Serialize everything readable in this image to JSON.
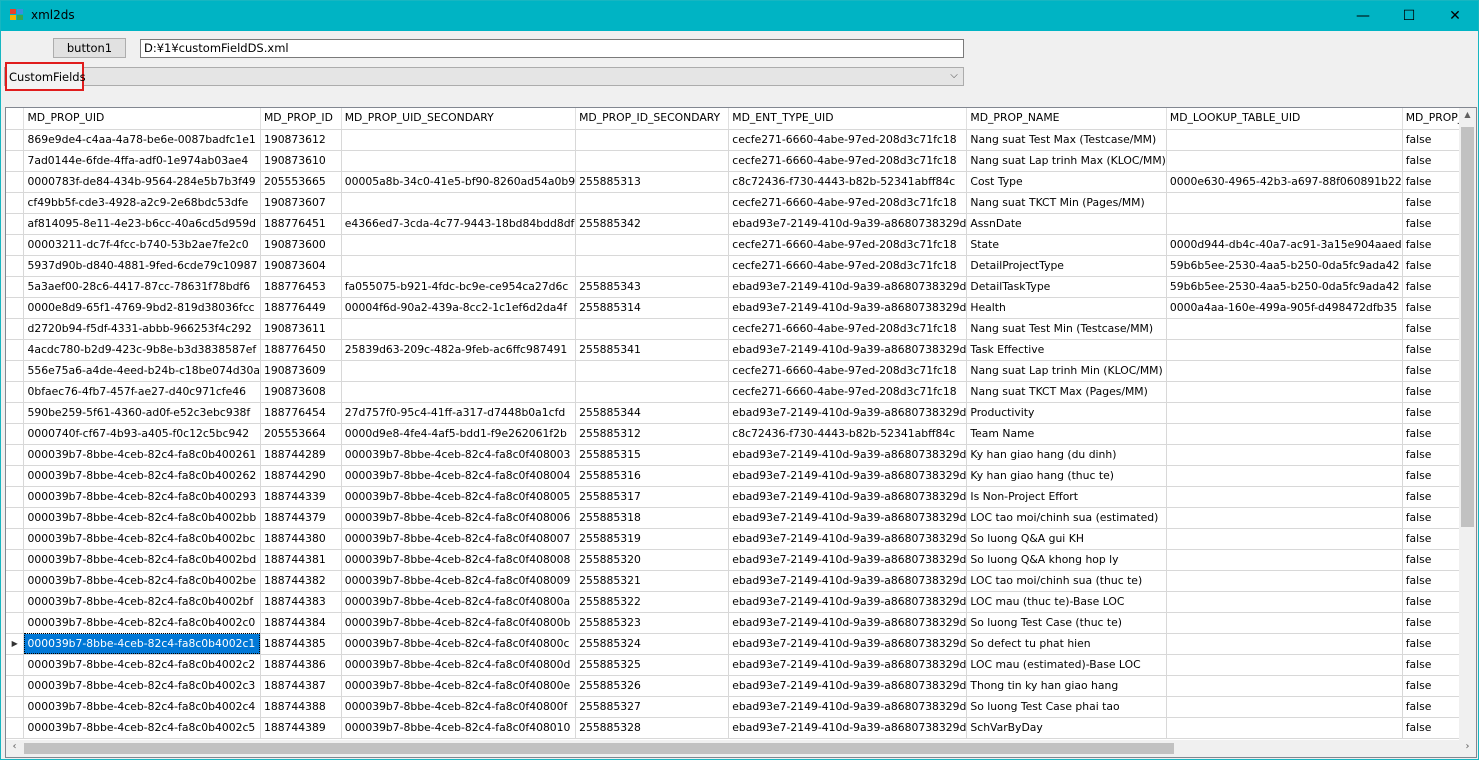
{
  "window": {
    "title": "xml2ds",
    "minimize_glyph": "—",
    "maximize_glyph": "☐",
    "close_glyph": "✕",
    "titlebar_color": "#00b4c4"
  },
  "toolbar": {
    "button1_label": "button1",
    "path_value": "D:¥1¥customFieldDS.xml",
    "combo_value": "CustomFields"
  },
  "grid": {
    "columns": [
      "MD_PROP_UID",
      "MD_PROP_ID",
      "MD_PROP_UID_SECONDARY",
      "MD_PROP_ID_SECONDARY",
      "MD_ENT_TYPE_UID",
      "MD_PROP_NAME",
      "MD_LOOKUP_TABLE_UID",
      "MD_PROP_I"
    ],
    "current_row_marker": "▶",
    "rows": [
      [
        "869e9de4-c4aa-4a78-be6e-0087badfc1e1",
        "190873612",
        "",
        "",
        "cecfe271-6660-4abe-97ed-208d3c71fc18",
        "Nang suat Test Max (Testcase/MM)",
        "",
        "false"
      ],
      [
        "7ad0144e-6fde-4ffa-adf0-1e974ab03ae4",
        "190873610",
        "",
        "",
        "cecfe271-6660-4abe-97ed-208d3c71fc18",
        "Nang suat Lap trinh Max (KLOC/MM)",
        "",
        "false"
      ],
      [
        "0000783f-de84-434b-9564-284e5b7b3f49",
        "205553665",
        "00005a8b-34c0-41e5-bf90-8260ad54a0b9",
        "255885313",
        "c8c72436-f730-4443-b82b-52341abff84c",
        "Cost Type",
        "0000e630-4965-42b3-a697-88f060891b22",
        "false"
      ],
      [
        "cf49bb5f-cde3-4928-a2c9-2e68bdc53dfe",
        "190873607",
        "",
        "",
        "cecfe271-6660-4abe-97ed-208d3c71fc18",
        "Nang suat TKCT Min (Pages/MM)",
        "",
        "false"
      ],
      [
        "af814095-8e11-4e23-b6cc-40a6cd5d959d",
        "188776451",
        "e4366ed7-3cda-4c77-9443-18bd84bdd8df",
        "255885342",
        "ebad93e7-2149-410d-9a39-a8680738329d",
        "AssnDate",
        "",
        "false"
      ],
      [
        "00003211-dc7f-4fcc-b740-53b2ae7fe2c0",
        "190873600",
        "",
        "",
        "cecfe271-6660-4abe-97ed-208d3c71fc18",
        "State",
        "0000d944-db4c-40a7-ac91-3a15e904aaed",
        "false"
      ],
      [
        "5937d90b-d840-4881-9fed-6cde79c10987",
        "190873604",
        "",
        "",
        "cecfe271-6660-4abe-97ed-208d3c71fc18",
        "DetailProjectType",
        "59b6b5ee-2530-4aa5-b250-0da5fc9ada42",
        "false"
      ],
      [
        "5a3aef00-28c6-4417-87cc-78631f78bdf6",
        "188776453",
        "fa055075-b921-4fdc-bc9e-ce954ca27d6c",
        "255885343",
        "ebad93e7-2149-410d-9a39-a8680738329d",
        "DetailTaskType",
        "59b6b5ee-2530-4aa5-b250-0da5fc9ada42",
        "false"
      ],
      [
        "0000e8d9-65f1-4769-9bd2-819d38036fcc",
        "188776449",
        "00004f6d-90a2-439a-8cc2-1c1ef6d2da4f",
        "255885314",
        "ebad93e7-2149-410d-9a39-a8680738329d",
        "Health",
        "0000a4aa-160e-499a-905f-d498472dfb35",
        "false"
      ],
      [
        "d2720b94-f5df-4331-abbb-966253f4c292",
        "190873611",
        "",
        "",
        "cecfe271-6660-4abe-97ed-208d3c71fc18",
        "Nang suat Test Min (Testcase/MM)",
        "",
        "false"
      ],
      [
        "4acdc780-b2d9-423c-9b8e-b3d3838587ef",
        "188776450",
        "25839d63-209c-482a-9feb-ac6ffc987491",
        "255885341",
        "ebad93e7-2149-410d-9a39-a8680738329d",
        "Task Effective",
        "",
        "false"
      ],
      [
        "556e75a6-a4de-4eed-b24b-c18be074d30a",
        "190873609",
        "",
        "",
        "cecfe271-6660-4abe-97ed-208d3c71fc18",
        "Nang suat Lap trinh Min (KLOC/MM)",
        "",
        "false"
      ],
      [
        "0bfaec76-4fb7-457f-ae27-d40c971cfe46",
        "190873608",
        "",
        "",
        "cecfe271-6660-4abe-97ed-208d3c71fc18",
        "Nang suat TKCT Max (Pages/MM)",
        "",
        "false"
      ],
      [
        "590be259-5f61-4360-ad0f-e52c3ebc938f",
        "188776454",
        "27d757f0-95c4-41ff-a317-d7448b0a1cfd",
        "255885344",
        "ebad93e7-2149-410d-9a39-a8680738329d",
        "Productivity",
        "",
        "false"
      ],
      [
        "0000740f-cf67-4b93-a405-f0c12c5bc942",
        "205553664",
        "0000d9e8-4fe4-4af5-bdd1-f9e262061f2b",
        "255885312",
        "c8c72436-f730-4443-b82b-52341abff84c",
        "Team Name",
        "",
        "false"
      ],
      [
        "000039b7-8bbe-4ceb-82c4-fa8c0b400261",
        "188744289",
        "000039b7-8bbe-4ceb-82c4-fa8c0f408003",
        "255885315",
        "ebad93e7-2149-410d-9a39-a8680738329d",
        "Ky han giao hang (du dinh)",
        "",
        "false"
      ],
      [
        "000039b7-8bbe-4ceb-82c4-fa8c0b400262",
        "188744290",
        "000039b7-8bbe-4ceb-82c4-fa8c0f408004",
        "255885316",
        "ebad93e7-2149-410d-9a39-a8680738329d",
        "Ky han giao hang (thuc te)",
        "",
        "false"
      ],
      [
        "000039b7-8bbe-4ceb-82c4-fa8c0b400293",
        "188744339",
        "000039b7-8bbe-4ceb-82c4-fa8c0f408005",
        "255885317",
        "ebad93e7-2149-410d-9a39-a8680738329d",
        "Is Non-Project Effort",
        "",
        "false"
      ],
      [
        "000039b7-8bbe-4ceb-82c4-fa8c0b4002bb",
        "188744379",
        "000039b7-8bbe-4ceb-82c4-fa8c0f408006",
        "255885318",
        "ebad93e7-2149-410d-9a39-a8680738329d",
        "LOC tao moi/chinh sua (estimated)",
        "",
        "false"
      ],
      [
        "000039b7-8bbe-4ceb-82c4-fa8c0b4002bc",
        "188744380",
        "000039b7-8bbe-4ceb-82c4-fa8c0f408007",
        "255885319",
        "ebad93e7-2149-410d-9a39-a8680738329d",
        "So luong Q&A gui KH",
        "",
        "false"
      ],
      [
        "000039b7-8bbe-4ceb-82c4-fa8c0b4002bd",
        "188744381",
        "000039b7-8bbe-4ceb-82c4-fa8c0f408008",
        "255885320",
        "ebad93e7-2149-410d-9a39-a8680738329d",
        "So luong Q&A khong hop ly",
        "",
        "false"
      ],
      [
        "000039b7-8bbe-4ceb-82c4-fa8c0b4002be",
        "188744382",
        "000039b7-8bbe-4ceb-82c4-fa8c0f408009",
        "255885321",
        "ebad93e7-2149-410d-9a39-a8680738329d",
        "LOC tao moi/chinh sua (thuc te)",
        "",
        "false"
      ],
      [
        "000039b7-8bbe-4ceb-82c4-fa8c0b4002bf",
        "188744383",
        "000039b7-8bbe-4ceb-82c4-fa8c0f40800a",
        "255885322",
        "ebad93e7-2149-410d-9a39-a8680738329d",
        "LOC mau (thuc te)-Base LOC",
        "",
        "false"
      ],
      [
        "000039b7-8bbe-4ceb-82c4-fa8c0b4002c0",
        "188744384",
        "000039b7-8bbe-4ceb-82c4-fa8c0f40800b",
        "255885323",
        "ebad93e7-2149-410d-9a39-a8680738329d",
        "So luong Test Case (thuc te)",
        "",
        "false"
      ],
      [
        "000039b7-8bbe-4ceb-82c4-fa8c0b4002c1",
        "188744385",
        "000039b7-8bbe-4ceb-82c4-fa8c0f40800c",
        "255885324",
        "ebad93e7-2149-410d-9a39-a8680738329d",
        "So defect tu phat hien",
        "",
        "false"
      ],
      [
        "000039b7-8bbe-4ceb-82c4-fa8c0b4002c2",
        "188744386",
        "000039b7-8bbe-4ceb-82c4-fa8c0f40800d",
        "255885325",
        "ebad93e7-2149-410d-9a39-a8680738329d",
        "LOC mau (estimated)-Base LOC",
        "",
        "false"
      ],
      [
        "000039b7-8bbe-4ceb-82c4-fa8c0b4002c3",
        "188744387",
        "000039b7-8bbe-4ceb-82c4-fa8c0f40800e",
        "255885326",
        "ebad93e7-2149-410d-9a39-a8680738329d",
        "Thong tin ky han giao hang",
        "",
        "false"
      ],
      [
        "000039b7-8bbe-4ceb-82c4-fa8c0b4002c4",
        "188744388",
        "000039b7-8bbe-4ceb-82c4-fa8c0f40800f",
        "255885327",
        "ebad93e7-2149-410d-9a39-a8680738329d",
        "So luong Test Case phai tao",
        "",
        "false"
      ],
      [
        "000039b7-8bbe-4ceb-82c4-fa8c0b4002c5",
        "188744389",
        "000039b7-8bbe-4ceb-82c4-fa8c0f408010",
        "255885328",
        "ebad93e7-2149-410d-9a39-a8680738329d",
        "SchVarByDay",
        "",
        "false"
      ]
    ],
    "selected_row_index": 24,
    "selection_color": "#0078d7"
  },
  "scrollbars": {
    "up_glyph": "▲",
    "left_glyph": "‹",
    "right_glyph": "›"
  }
}
